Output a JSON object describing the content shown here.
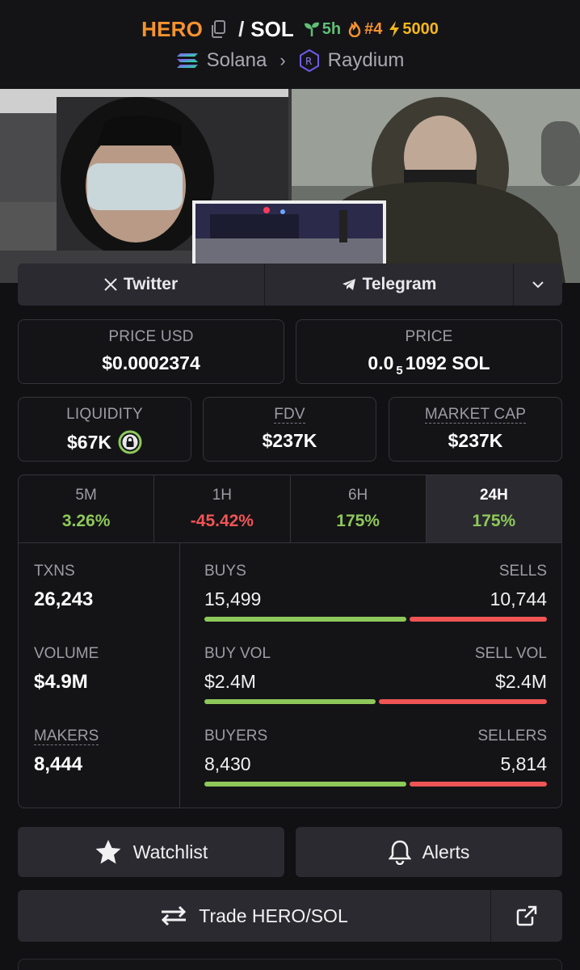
{
  "header": {
    "base_symbol": "HERO",
    "slash": "/",
    "quote_symbol": "SOL",
    "age": "5h",
    "rank": "#4",
    "boost": "5000",
    "chain": "Solana",
    "dex": "Raydium"
  },
  "links": {
    "twitter": "Twitter",
    "telegram": "Telegram"
  },
  "prices": {
    "price_usd_label": "PRICE USD",
    "price_usd_value": "$0.0002374",
    "price_label": "PRICE",
    "price_prefix": "0.0",
    "price_subscript": "5",
    "price_suffix": "1092 SOL"
  },
  "metrics": {
    "liquidity_label": "LIQUIDITY",
    "liquidity_value": "$67K",
    "fdv_label": "FDV",
    "fdv_value": "$237K",
    "mcap_label": "MARKET CAP",
    "mcap_value": "$237K"
  },
  "timeframes": [
    {
      "label": "5M",
      "change": "3.26%"
    },
    {
      "label": "1H",
      "change": "-45.42%"
    },
    {
      "label": "6H",
      "change": "175%"
    },
    {
      "label": "24H",
      "change": "175%"
    }
  ],
  "stats": {
    "txns_label": "TXNS",
    "txns_value": "26,243",
    "volume_label": "VOLUME",
    "volume_value": "$4.9M",
    "makers_label": "MAKERS",
    "makers_value": "8,444",
    "buys_label": "BUYS",
    "buys_value": "15,499",
    "sells_label": "SELLS",
    "sells_value": "10,744",
    "buy_vol_label": "BUY VOL",
    "buy_vol_value": "$2.4M",
    "sell_vol_label": "SELL VOL",
    "sell_vol_value": "$2.4M",
    "buyers_label": "BUYERS",
    "buyers_value": "8,430",
    "sellers_label": "SELLERS",
    "sellers_value": "5,814",
    "buys_ratio": 0.59,
    "buy_vol_ratio": 0.5,
    "buyers_ratio": 0.59
  },
  "actions": {
    "watchlist": "Watchlist",
    "alerts": "Alerts",
    "trade": "Trade HERO/SOL"
  },
  "colors": {
    "base": "#f5922f",
    "positive": "#8ec85a",
    "negative": "#f05454",
    "age": "#5fbf76",
    "boost": "#f3b81b"
  }
}
